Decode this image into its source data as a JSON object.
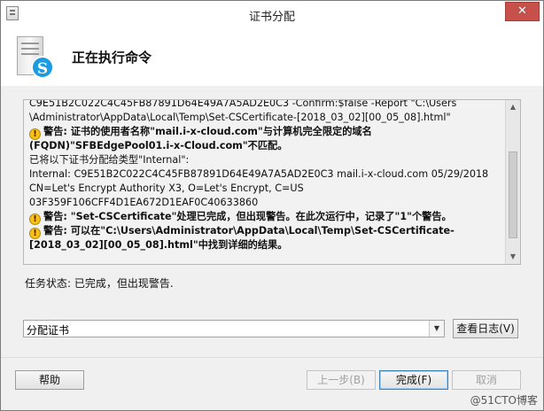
{
  "window": {
    "title": "证书分配",
    "close_label": "✕"
  },
  "header": {
    "title": "正在执行命令",
    "icon": "server-skype-icon"
  },
  "log": {
    "lines": [
      {
        "type": "text",
        "text": "C9E51B2C022C4C45FB87891D64E49A7A5AD2E0C3 -Confirm:$false -Report \"C:\\Users"
      },
      {
        "type": "text",
        "text": "\\Administrator\\AppData\\Local\\Temp\\Set-CSCertificate-[2018_03_02][00_05_08].html\""
      },
      {
        "type": "warn",
        "text": "警告: 证书的使用者名称\"mail.i-x-cloud.com\"与计算机完全限定的域名"
      },
      {
        "type": "warn-cont",
        "text": "(FQDN)\"SFBEdgePool01.i-x-Cloud.com\"不匹配。"
      },
      {
        "type": "text",
        "text": "已将以下证书分配给类型\"Internal\":"
      },
      {
        "type": "text",
        "text": "Internal: C9E51B2C022C4C45FB87891D64E49A7A5AD2E0C3 mail.i-x-cloud.com 05/29/2018"
      },
      {
        "type": "text",
        "text": "CN=Let's Encrypt Authority X3, O=Let's Encrypt, C=US"
      },
      {
        "type": "text",
        "text": "03F359F106CFF4D1EA672D1EAF0C40633860"
      },
      {
        "type": "warn",
        "text": "警告: \"Set-CSCertificate\"处理已完成，但出现警告。在此次运行中，记录了\"1\"个警告。"
      },
      {
        "type": "warn",
        "text": "警告: 可以在\"C:\\Users\\Administrator\\AppData\\Local\\Temp\\Set-CSCertificate-"
      },
      {
        "type": "warn-cont",
        "text": "[2018_03_02][00_05_08].html\"中找到详细的结果。"
      }
    ]
  },
  "status": {
    "text": "任务状态: 已完成，但出现警告."
  },
  "combo": {
    "value": "分配证书"
  },
  "buttons": {
    "view_log": "查看日志(V)",
    "help": "帮助",
    "back": "上一步(B)",
    "finish": "完成(F)",
    "cancel": "取消"
  },
  "watermark": "@51CTO博客"
}
